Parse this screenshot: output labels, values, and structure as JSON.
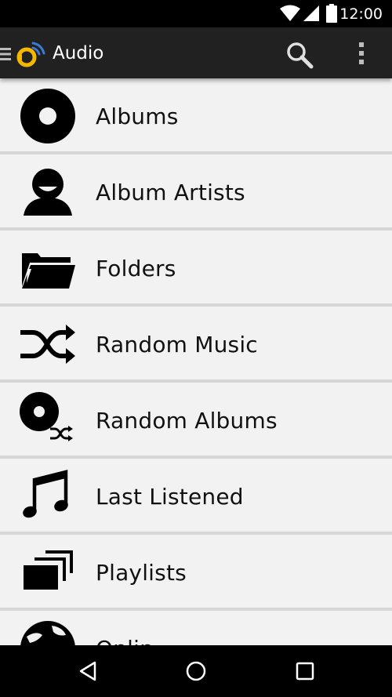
{
  "status_bar": {
    "time": "12:00"
  },
  "action_bar": {
    "title": "Audio",
    "icons": [
      "hamburger-icon",
      "app-logo-icon",
      "search-icon",
      "overflow-menu-icon"
    ]
  },
  "menu": {
    "items": [
      {
        "label": "Albums",
        "icon": "disc-icon"
      },
      {
        "label": "Album Artists",
        "icon": "person-icon"
      },
      {
        "label": "Folders",
        "icon": "folder-icon"
      },
      {
        "label": "Random Music",
        "icon": "shuffle-icon"
      },
      {
        "label": "Random Albums",
        "icon": "disc-shuffle-icon"
      },
      {
        "label": "Last Listened",
        "icon": "music-note-icon"
      },
      {
        "label": "Playlists",
        "icon": "playlists-icon"
      },
      {
        "label": "Onlin",
        "icon": "globe-icon"
      }
    ]
  },
  "nav_bar": {
    "icons": [
      "back-icon",
      "home-icon",
      "recents-icon"
    ]
  },
  "colors": {
    "status_bar": "#000000",
    "action_bar": "#212121",
    "list_bg": "#f2f2f2",
    "divider": "#d6d6d6",
    "logo_yellow": "#f5b800",
    "logo_blue": "#3a7bd5"
  }
}
